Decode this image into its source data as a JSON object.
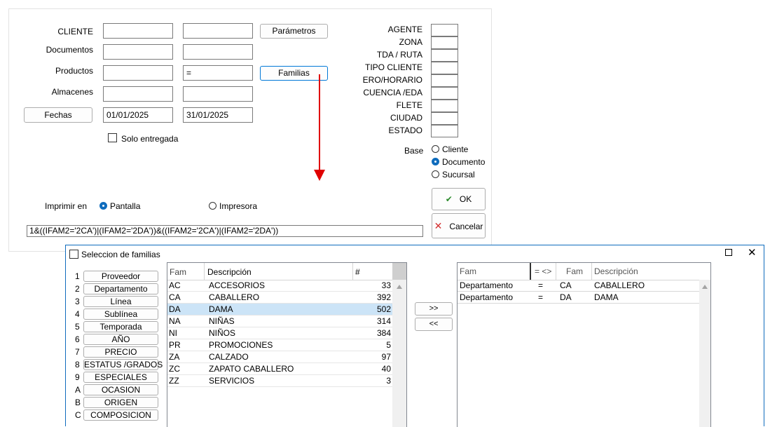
{
  "form": {
    "cliente_label": "CLIENTE",
    "documentos_label": "Documentos",
    "productos_label": "Productos",
    "almacenes_label": "Almacenes",
    "fechas_button": "Fechas",
    "fecha_inicio": "01/01/2025",
    "fecha_fin": "31/01/2025",
    "productos_operator": "=",
    "parametros_button": "Parámetros",
    "familias_button": "Familias",
    "solo_entregada": "Solo entregada",
    "right_labels": [
      "AGENTE",
      "ZONA",
      "TDA / RUTA",
      "TIPO CLIENTE",
      "ERO/HORARIO",
      "CUENCIA /EDA",
      "FLETE",
      "CIUDAD",
      "ESTADO"
    ],
    "base_label": "Base",
    "base_options": [
      "Cliente",
      "Documento",
      "Sucursal"
    ],
    "base_selected": "Documento",
    "imprimir_label": "Imprimir en",
    "imprimir_options": [
      "Pantalla",
      "Impresora"
    ],
    "imprimir_selected": "Pantalla",
    "ok_button": "OK",
    "cancel_button": "Cancelar",
    "expression": "1&((IFAM2='2CA')|(IFAM2='2DA'))&((IFAM2='2CA')|(IFAM2='2DA'))",
    "colors": {
      "ok_check": "#2a8a2a",
      "cancel_x": "#d32f2f",
      "arrow": "#e00000",
      "accent": "#0f6cbd"
    }
  },
  "dialog": {
    "title": "Seleccion de familias",
    "categories": [
      {
        "key": "1",
        "label": "Proveedor"
      },
      {
        "key": "2",
        "label": "Departamento"
      },
      {
        "key": "3",
        "label": "Línea"
      },
      {
        "key": "4",
        "label": "Sublínea"
      },
      {
        "key": "5",
        "label": "Temporada"
      },
      {
        "key": "6",
        "label": "AÑO"
      },
      {
        "key": "7",
        "label": "PRECIO"
      },
      {
        "key": "8",
        "label": "ESTATUS /GRADOS"
      },
      {
        "key": "9",
        "label": "ESPECIALES"
      },
      {
        "key": "A",
        "label": "OCASION"
      },
      {
        "key": "B",
        "label": "ORIGEN"
      },
      {
        "key": "C",
        "label": "COMPOSICION"
      }
    ],
    "families_headers": [
      "Fam",
      "Descripción",
      "#"
    ],
    "families": [
      {
        "fam": "AC",
        "desc": "ACCESORIOS",
        "count": "33"
      },
      {
        "fam": "CA",
        "desc": "CABALLERO",
        "count": "392"
      },
      {
        "fam": "DA",
        "desc": "DAMA",
        "count": "502"
      },
      {
        "fam": "NA",
        "desc": "NIÑAS",
        "count": "314"
      },
      {
        "fam": "NI",
        "desc": "NIÑOS",
        "count": "384"
      },
      {
        "fam": "PR",
        "desc": "PROMOCIONES",
        "count": "5"
      },
      {
        "fam": "ZA",
        "desc": "CALZADO",
        "count": "97"
      },
      {
        "fam": "ZC",
        "desc": "ZAPATO CABALLERO",
        "count": "40"
      },
      {
        "fam": "ZZ",
        "desc": "SERVICIOS",
        "count": "3"
      }
    ],
    "selected_family": "DA",
    "add_button": ">>",
    "remove_button": "<<",
    "selected_headers": [
      "Fam",
      "= <>",
      "Fam",
      "Descripción"
    ],
    "selected": [
      {
        "group": "Departamento",
        "op": "=",
        "fam": "CA",
        "desc": "CABALLERO"
      },
      {
        "group": "Departamento",
        "op": "=",
        "fam": "DA",
        "desc": "DAMA"
      }
    ]
  }
}
